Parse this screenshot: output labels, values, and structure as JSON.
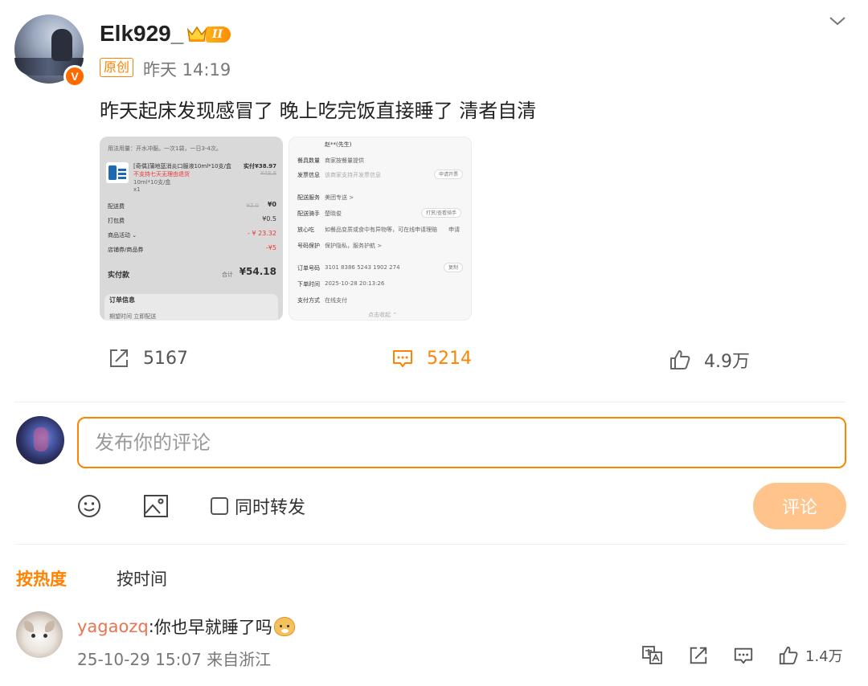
{
  "post": {
    "username": "Elk929_",
    "vip_level": "II",
    "original_tag": "原创",
    "time": "昨天 14:19",
    "text": "昨天起床发现感冒了 晚上吃完饭直接睡了 清者自清",
    "images": {
      "left": {
        "usage": "用法用量：开水冲服。一次1袋，一日3-4次。",
        "product": "[奇偶]蒲地蓝消炎口服液10ml*10支/盒",
        "tag": "不支持七天无理由退货",
        "spec": "10ml*10支/盒",
        "qty": "x1",
        "price": "实付¥38.97",
        "orig_price": "¥48.8",
        "rows": [
          {
            "label": "配送费",
            "value": "¥0",
            "strike": "¥2.0"
          },
          {
            "label": "打包费",
            "value": "¥0.5"
          },
          {
            "label": "商品活动 ⌄",
            "value": "- ¥ 23.32"
          },
          {
            "label": "店铺券/商品券",
            "value": "-¥5"
          }
        ],
        "total_label": "实付款",
        "total_prefix": "合计",
        "total_value": "¥54.18",
        "order_info": "订单信息",
        "expected_time": "期望时间  立即配送"
      },
      "right": {
        "recipient": "赵**(先生)",
        "rows": [
          {
            "label": "餐具数量",
            "value": "商家按餐量提供"
          },
          {
            "label": "发票信息",
            "value": "该商家支持开发票信息",
            "chip": "申请开票"
          },
          {
            "label": "配送服务",
            "value": "美团专送 >"
          },
          {
            "label": "配送骑手",
            "value": "楚晓俊",
            "chip": "打赏/查看骑手"
          },
          {
            "label": "放心吃",
            "value": "如餐品变质或食中有异物等，可在线申请理赔",
            "chip": "申请"
          },
          {
            "label": "号码保护",
            "value": "保护隐私，服务护航 >"
          },
          {
            "label": "订单号码",
            "value": "3101 8386 5243 1902 274",
            "chip": "复制"
          },
          {
            "label": "下单时间",
            "value": "2025-10-28 20:13:26"
          },
          {
            "label": "支付方式",
            "value": "在线支付"
          }
        ],
        "more": "点击收起 ⌃"
      }
    }
  },
  "actions": {
    "share_count": "5167",
    "comment_count": "5214",
    "like_count": "4.9万"
  },
  "composer": {
    "placeholder": "发布你的评论",
    "repost_label": "同时转发",
    "submit_label": "评论"
  },
  "sort": {
    "hot": "按热度",
    "time": "按时间"
  },
  "comments": [
    {
      "username": "yagaozq",
      "separator": ":",
      "text": "你也早就睡了吗",
      "meta": "25-10-29 15:07 来自浙江",
      "likes": "1.4万"
    }
  ],
  "colors": {
    "accent": "#ff8200",
    "submit_disabled": "#ffc48b",
    "username_link": "#eb7350"
  }
}
